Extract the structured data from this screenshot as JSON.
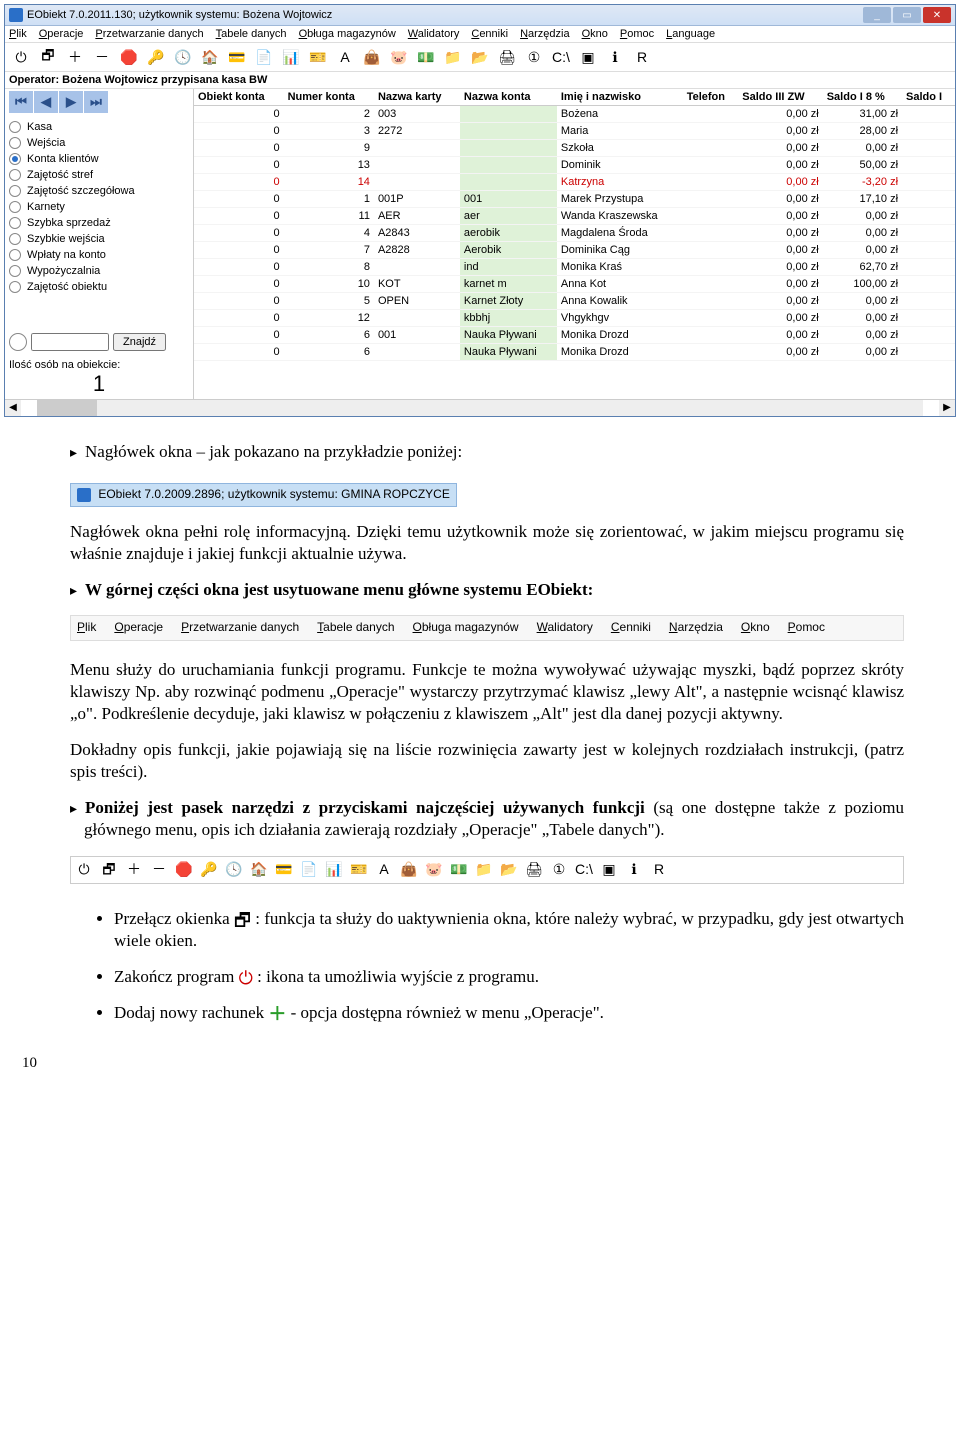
{
  "window": {
    "title": "EObiekt 7.0.2011.130; użytkownik systemu: Bożena Wojtowicz",
    "menus": [
      "Plik",
      "Operacje",
      "Przetwarzanie danych",
      "Tabele danych",
      "Obługa magazynów",
      "Walidatory",
      "Cenniki",
      "Narzędzia",
      "Okno",
      "Pomoc",
      "Language"
    ],
    "operator": "Operator: Bożena Wojtowicz przypisana kasa BW",
    "toolbar_icons": [
      "power",
      "cascade",
      "plus",
      "minus",
      "stop",
      "key",
      "clock",
      "home",
      "card",
      "doc",
      "chart",
      "badge",
      "A",
      "bag",
      "piggy",
      "cash",
      "folder1",
      "folder2",
      "print",
      "circle1",
      "console",
      "square",
      "info",
      "R"
    ]
  },
  "side": {
    "items": [
      "Kasa",
      "Wejścia",
      "Konta klientów",
      "Zajętość stref",
      "Zajętość szczegółowa",
      "Karnety",
      "Szybka sprzedaż",
      "Szybkie wejścia",
      "Wpłaty na konto",
      "Wypożyczalnia",
      "Zajętość obiektu"
    ],
    "active_index": 2,
    "find_btn": "Znajdź",
    "count_label": "Ilość osób na obiekcie:",
    "count_value": "1"
  },
  "grid": {
    "headers": [
      "Obiekt konta",
      "Numer konta",
      "Nazwa karty",
      "Nazwa konta",
      "Imię i nazwisko",
      "Telefon",
      "Saldo III ZW",
      "Saldo I 8 %",
      "Saldo I"
    ],
    "rows": [
      {
        "c": [
          "0",
          "2",
          "003",
          "",
          "Bożena",
          "",
          "0,00 zł",
          "31,00 zł",
          ""
        ]
      },
      {
        "c": [
          "0",
          "3",
          "2272",
          "",
          "Maria",
          "",
          "0,00 zł",
          "28,00 zł",
          ""
        ]
      },
      {
        "c": [
          "0",
          "9",
          "",
          "",
          "Szkoła",
          "",
          "0,00 zł",
          "0,00 zł",
          ""
        ]
      },
      {
        "c": [
          "0",
          "13",
          "",
          "",
          "Dominik",
          "",
          "0,00 zł",
          "50,00 zł",
          ""
        ]
      },
      {
        "c": [
          "0",
          "14",
          "",
          "",
          "Katrzyna",
          "",
          "0,00 zł",
          "-3,20 zł",
          ""
        ],
        "red": true
      },
      {
        "c": [
          "0",
          "1",
          "001P",
          "001",
          "Marek Przystupa",
          "",
          "0,00 zł",
          "17,10 zł",
          ""
        ]
      },
      {
        "c": [
          "0",
          "11",
          "AER",
          "aer",
          "Wanda Kraszewska",
          "",
          "0,00 zł",
          "0,00 zł",
          ""
        ]
      },
      {
        "c": [
          "0",
          "4",
          "A2843",
          "aerobik",
          "Magdalena Środa",
          "",
          "0,00 zł",
          "0,00 zł",
          ""
        ]
      },
      {
        "c": [
          "0",
          "7",
          "A2828",
          "Aerobik",
          "Dominika Cąg",
          "",
          "0,00 zł",
          "0,00 zł",
          ""
        ]
      },
      {
        "c": [
          "0",
          "8",
          "",
          "ind",
          "Monika Kraś",
          "",
          "0,00 zł",
          "62,70 zł",
          ""
        ]
      },
      {
        "c": [
          "0",
          "10",
          "KOT",
          "karnet m",
          "Anna Kot",
          "",
          "0,00 zł",
          "100,00 zł",
          ""
        ]
      },
      {
        "c": [
          "0",
          "5",
          "OPEN",
          "Karnet Złoty",
          "Anna Kowalik",
          "",
          "0,00 zł",
          "0,00 zł",
          ""
        ]
      },
      {
        "c": [
          "0",
          "12",
          "",
          "kbbhj",
          "Vhgykhgv",
          "",
          "0,00 zł",
          "0,00 zł",
          ""
        ]
      },
      {
        "c": [
          "0",
          "6",
          "001",
          "Nauka Pływani",
          "Monika Drozd",
          "",
          "0,00 zł",
          "0,00 zł",
          ""
        ]
      },
      {
        "c": [
          "0",
          "6",
          "",
          "Nauka Pływani",
          "Monika Drozd",
          "",
          "0,00 zł",
          "0,00 zł",
          ""
        ]
      }
    ]
  },
  "doc": {
    "b1": "Nagłówek okna – jak pokazano na przykładzie poniżej:",
    "title_ex": "EObiekt 7.0.2009.2896; użytkownik systemu: GMINA ROPCZYCE",
    "p1": "Nagłówek okna pełni rolę informacyjną. Dzięki temu użytkownik może się zorientować, w jakim miejscu programu się właśnie znajduje i jakiej funkcji aktualnie używa.",
    "b2": "W górnej części okna jest usytuowane menu główne systemu EObiekt:",
    "menu2": [
      "Plik",
      "Operacje",
      "Przetwarzanie danych",
      "Tabele danych",
      "Obługa magazynów",
      "Walidatory",
      "Cenniki",
      "Narzędzia",
      "Okno",
      "Pomoc"
    ],
    "p2": "Menu służy do uruchamiania funkcji programu. Funkcje te można wywoływać używając myszki, bądź poprzez skróty klawiszy Np. aby rozwinąć podmenu „Operacje\" wystarczy przytrzymać klawisz „lewy Alt\", a następnie wcisnąć klawisz „o\". Podkreślenie decyduje, jaki klawisz w połączeniu z klawiszem „Alt\" jest dla danej pozycji aktywny.",
    "p3": "Dokładny opis funkcji, jakie pojawiają się na liście rozwinięcia zawarty jest w kolejnych rozdziałach instrukcji, (patrz spis treści).",
    "b3a": "Poniżej jest pasek narzędzi z przyciskami najczęściej używanych funkcji",
    "b3b": " (są one dostępne także z poziomu głównego menu, opis ich działania zawierają rozdziały „Operacje\" „Tabele danych\").",
    "li1a": "Przełącz okienka ",
    "li1b": " : funkcja ta służy do uaktywnienia okna, które należy wybrać, w przypadku, gdy jest otwartych wiele okien.",
    "li2a": "Zakończ program ",
    "li2b": " : ikona ta umożliwia wyjście z programu.",
    "li3a": "Dodaj nowy rachunek ",
    "li3b": " - opcja dostępna również w menu „Operacje\".",
    "page": "10"
  },
  "toolbar_glyph": {
    "power": "⏻",
    "cascade": "🗗",
    "plus": "＋",
    "minus": "－",
    "stop": "🛑",
    "key": "🔑",
    "clock": "🕓",
    "home": "🏠",
    "card": "💳",
    "doc": "📄",
    "chart": "📊",
    "badge": "🎫",
    "A": "A",
    "bag": "👜",
    "piggy": "🐷",
    "cash": "💵",
    "folder1": "📁",
    "folder2": "📂",
    "print": "🖨",
    "circle1": "①",
    "console": "C:\\",
    "square": "▣",
    "info": "ℹ",
    "R": "R"
  }
}
